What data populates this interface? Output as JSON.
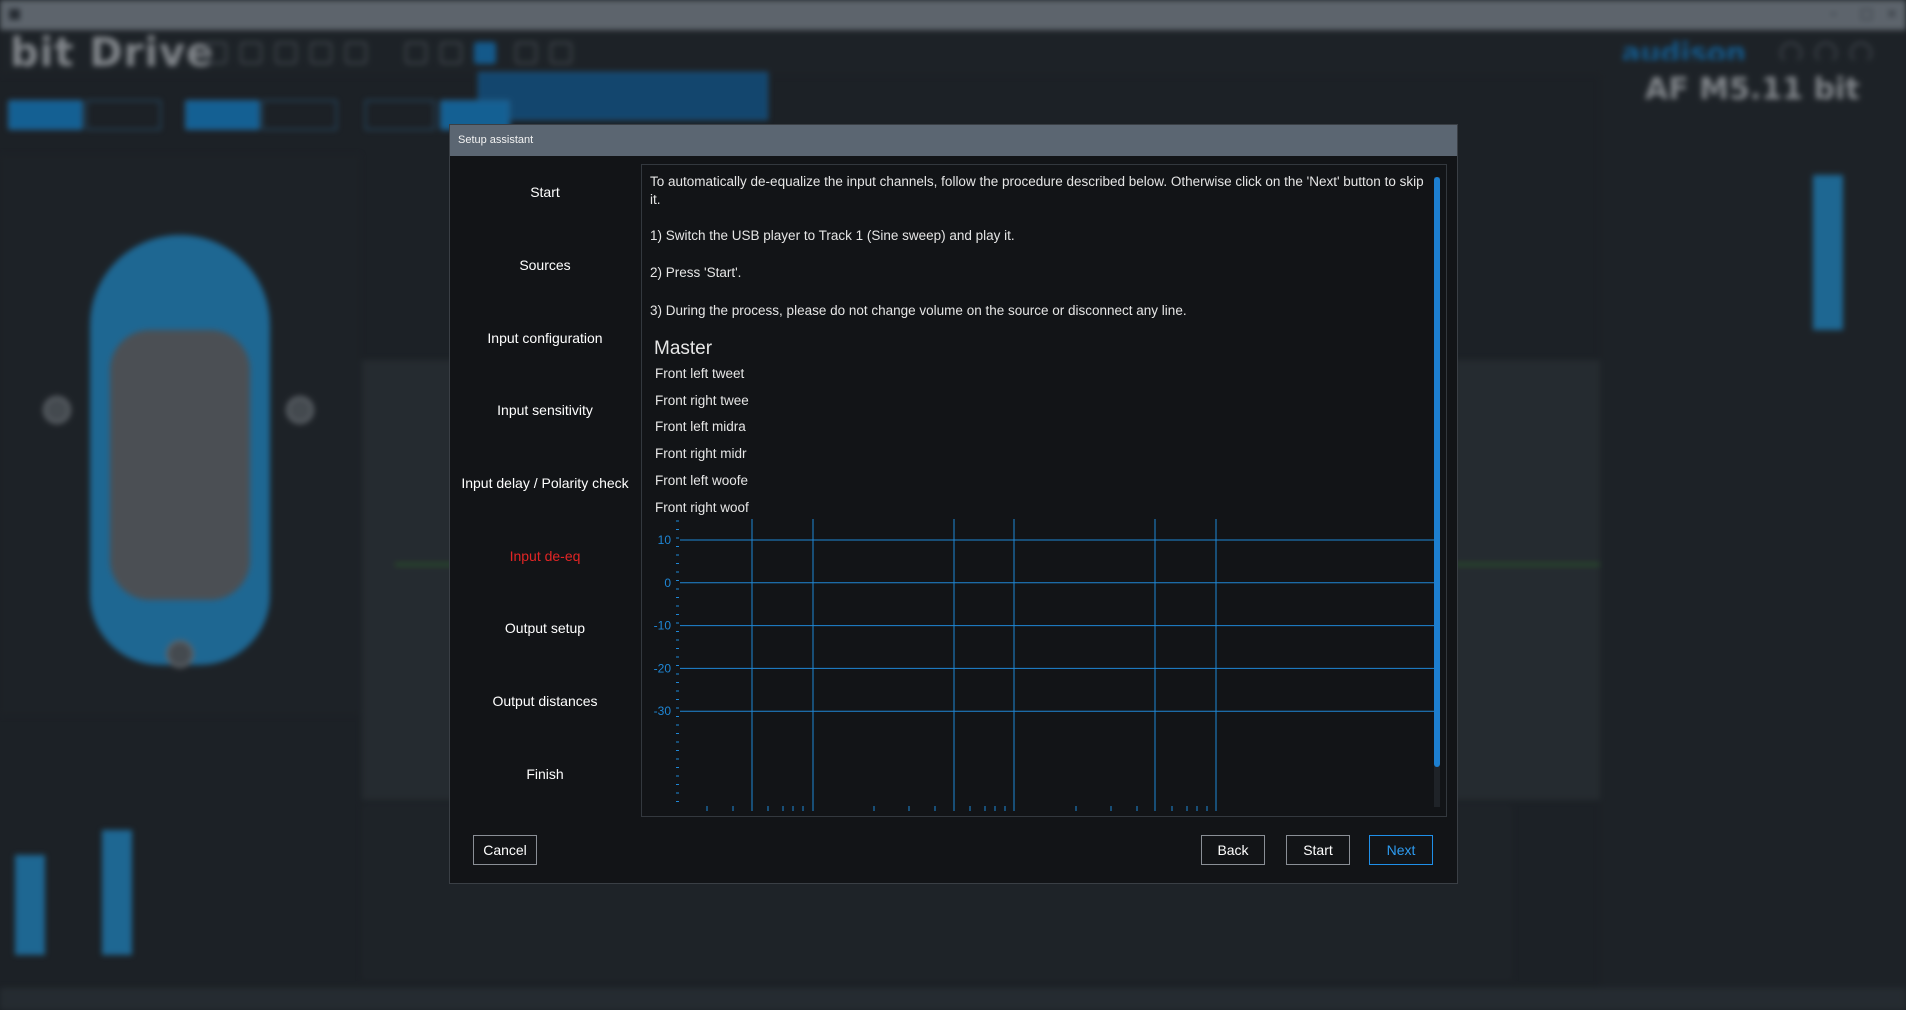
{
  "dialog": {
    "title": "Setup assistant",
    "nav": [
      {
        "label": "Start",
        "active": false
      },
      {
        "label": "Sources",
        "active": false
      },
      {
        "label": "Input configuration",
        "active": false
      },
      {
        "label": "Input sensitivity",
        "active": false
      },
      {
        "label": "Input delay / Polarity check",
        "active": false
      },
      {
        "label": "Input de-eq",
        "active": true
      },
      {
        "label": "Output setup",
        "active": false
      },
      {
        "label": "Output distances",
        "active": false
      },
      {
        "label": "Finish",
        "active": false
      }
    ],
    "instructions": {
      "intro": "To automatically de-equalize the input channels, follow the procedure described below. Otherwise click on the 'Next' button to skip it.",
      "step1": "1) Switch the USB player to Track 1 (Sine sweep) and play it.",
      "step2": "2) Press 'Start'.",
      "step3": "3) During the process, please do not change volume on the source or disconnect any line."
    },
    "master_label": "Master",
    "channels": [
      "Front left tweet",
      "Front right twee",
      "Front left midra",
      "Front right midr",
      "Front left woofe",
      "Front right woof"
    ],
    "buttons": {
      "cancel": "Cancel",
      "back": "Back",
      "start": "Start",
      "next": "Next"
    }
  },
  "chart_data": {
    "type": "line",
    "y_ticks": [
      10,
      0,
      -10,
      -20,
      -30
    ],
    "grid": true,
    "series": []
  },
  "colors": {
    "accent": "#1d8fe0",
    "active_nav": "#e22525",
    "grid": "#1f87d6",
    "dialog_bg": "#121417"
  }
}
